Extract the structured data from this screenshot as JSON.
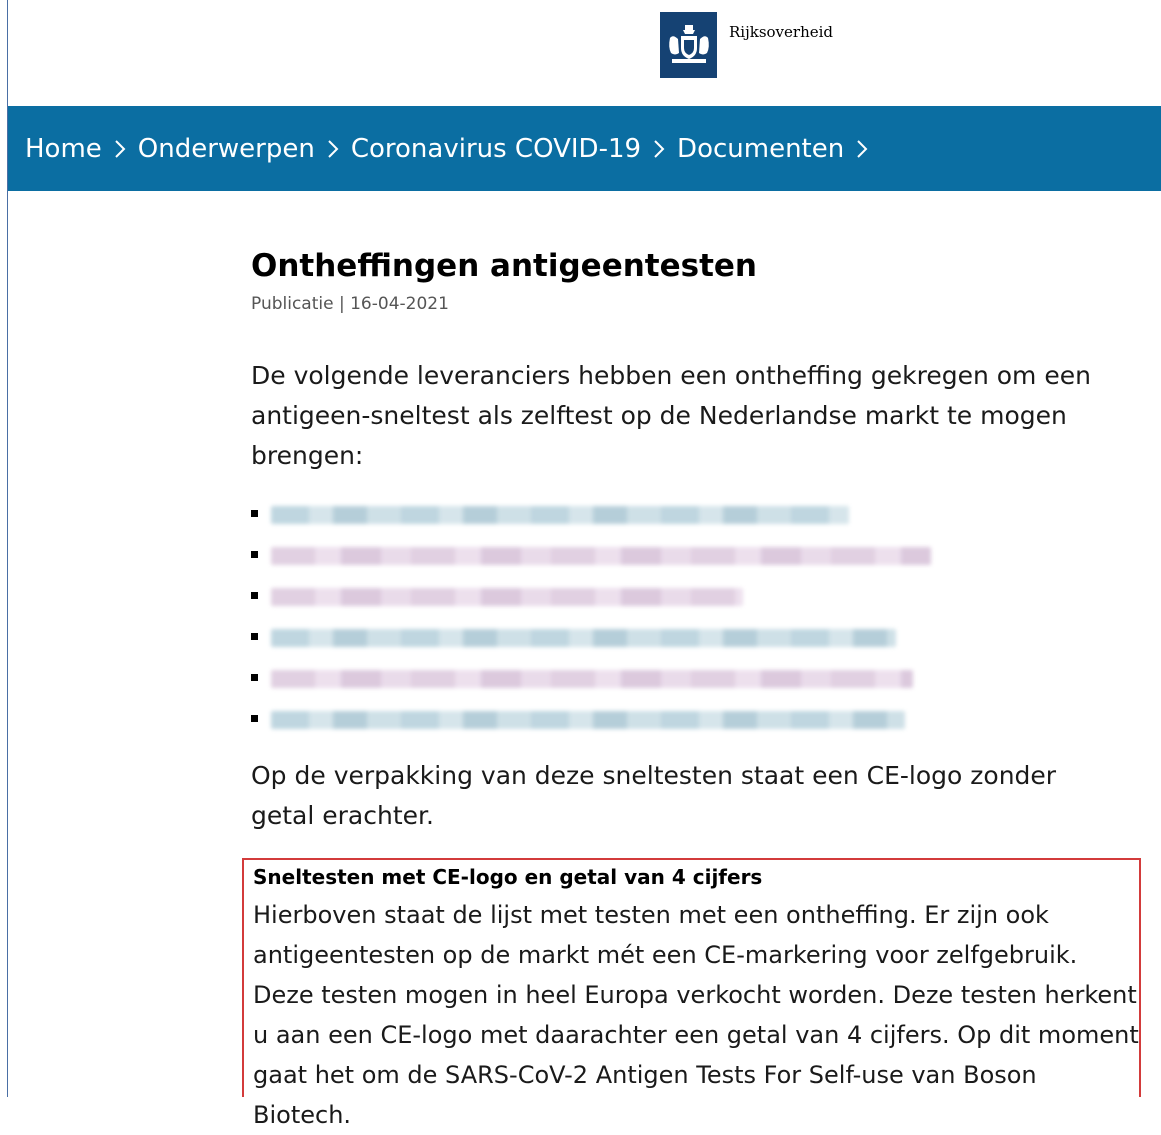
{
  "header": {
    "brand": "Rijksoverheid",
    "logo_icon": "royal-coat-of-arms"
  },
  "breadcrumb": [
    {
      "label": "Home"
    },
    {
      "label": "Onderwerpen"
    },
    {
      "label": "Coronavirus COVID-19"
    },
    {
      "label": "Documenten"
    }
  ],
  "page": {
    "title": "Ontheffingen antigeentesten",
    "meta": "Publicatie | 16-04-2021",
    "intro": "De volgende leveranciers hebben een ontheffing gekregen om een antigeen-sneltest als zelftest op de Nederlandse markt te mogen brengen:",
    "outro": "Op de verpakking van deze sneltesten staat een CE-logo zonder getal erachter."
  },
  "callout": {
    "heading": "Sneltesten met CE-logo en getal van 4 cijfers",
    "body": "Hierboven staat de lijst met testen met een ontheffing. Er zijn ook antigeentesten op de markt mét een CE-markering voor zelfgebruik. Deze testen mogen in heel Europa verkocht worden. Deze testen herkent u aan een CE-logo met daarachter een getal van 4 cijfers. Op dit moment gaat het om de SARS-CoV-2 Antigen Tests For Self-use van Boson Biotech."
  },
  "colors": {
    "nav": "#0b6ea2",
    "logo_bg": "#154273",
    "callout_border": "#d33b3b"
  }
}
